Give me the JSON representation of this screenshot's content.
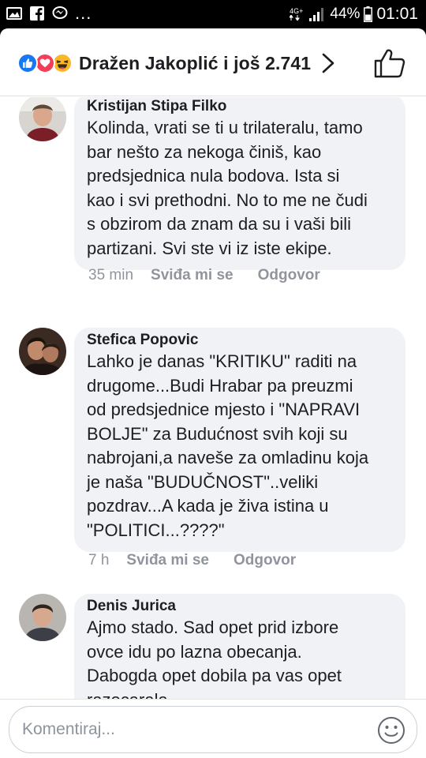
{
  "status_bar": {
    "dots": "...",
    "network_top": "4G+",
    "battery": "44%",
    "time": "01:01"
  },
  "header": {
    "title": "Dražen Jakoplić i još 2.741",
    "reaction_icons": [
      "like-icon",
      "love-icon",
      "haha-icon"
    ]
  },
  "comments": [
    {
      "author": "Kristijan Stipa Filko",
      "text": "Kolinda, vrati se ti u trilateralu, tamo\nbar nešto za nekoga činiš, kao\npredsjednica nula bodova. Ista si\nkao i svi prethodni. No to me ne čudi\ns obzirom da znam da su i vaši bili\npartizani. Svi ste vi iz iste ekipe.",
      "time": "35 min",
      "like_label": "Sviđa mi se",
      "reply_label": "Odgovor"
    },
    {
      "author": "Stefica Popovic",
      "text": "Lahko je danas \"KRITIKU\" raditi na\ndrugome...Budi Hrabar pa preuzmi\nod predsjednice mjesto i \"NAPRAVI\nBOLJE\" za Budućnost svih koji su\nnabrojani,a naveše za omladinu koja\nje naša \"BUDUČNOST\"..veliki\npozdrav...A kada je živa istina u\n\"POLITICI...????\"",
      "time": "7 h",
      "like_label": "Sviđa mi se",
      "reply_label": "Odgovor"
    },
    {
      "author": "Denis Jurica",
      "text": "Ajmo stado. Sad opet prid izbore\novce idu po lazna obecanja.\nDabogda opet dobila pa vas opet\nrazocarala"
    }
  ],
  "footer": {
    "placeholder": "Komentiraj..."
  }
}
